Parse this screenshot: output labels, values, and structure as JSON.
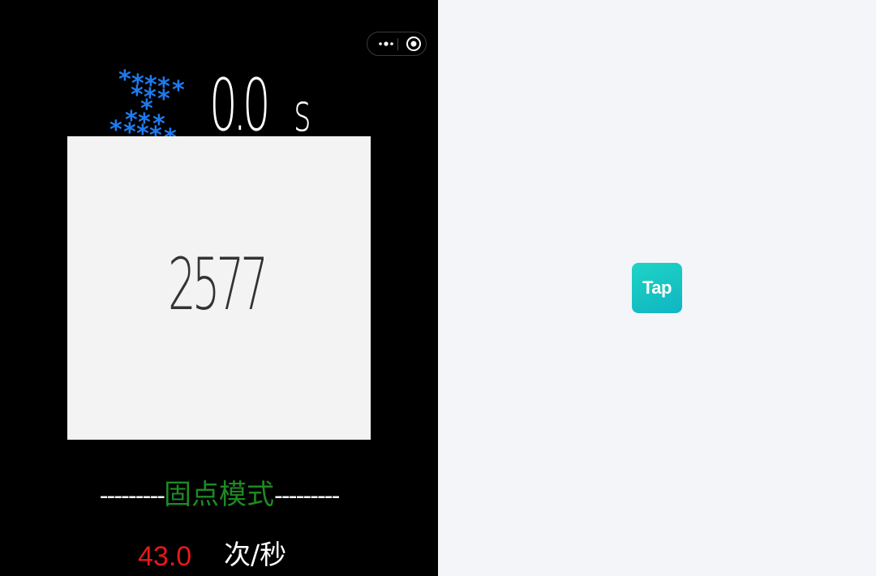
{
  "game": {
    "timer": {
      "value": "0.0",
      "unit": "s",
      "icon": "hourglass-stars-icon",
      "glyph": "*"
    },
    "tap_area": {
      "count": "2577"
    },
    "mode": {
      "dashes_left": "---------",
      "name": "固点模式",
      "dashes_right": "---------"
    },
    "speed": {
      "value": "43.0",
      "unit": "次/秒"
    }
  },
  "capsule": {
    "more_icon": "more-dots-icon",
    "close_icon": "close-target-icon"
  },
  "side": {
    "logo": {
      "text": "Tap",
      "icon": "taptap-logo-icon"
    }
  },
  "colors": {
    "game_background": "#000000",
    "side_background": "#f4f5f9",
    "tap_area": "#f3f3f3",
    "stars": "#1e7bf0",
    "mode_name": "#1d8a24",
    "speed_value": "#e81818",
    "logo_gradient_start": "#1fd4c6",
    "logo_gradient_end": "#0fb5c4"
  }
}
